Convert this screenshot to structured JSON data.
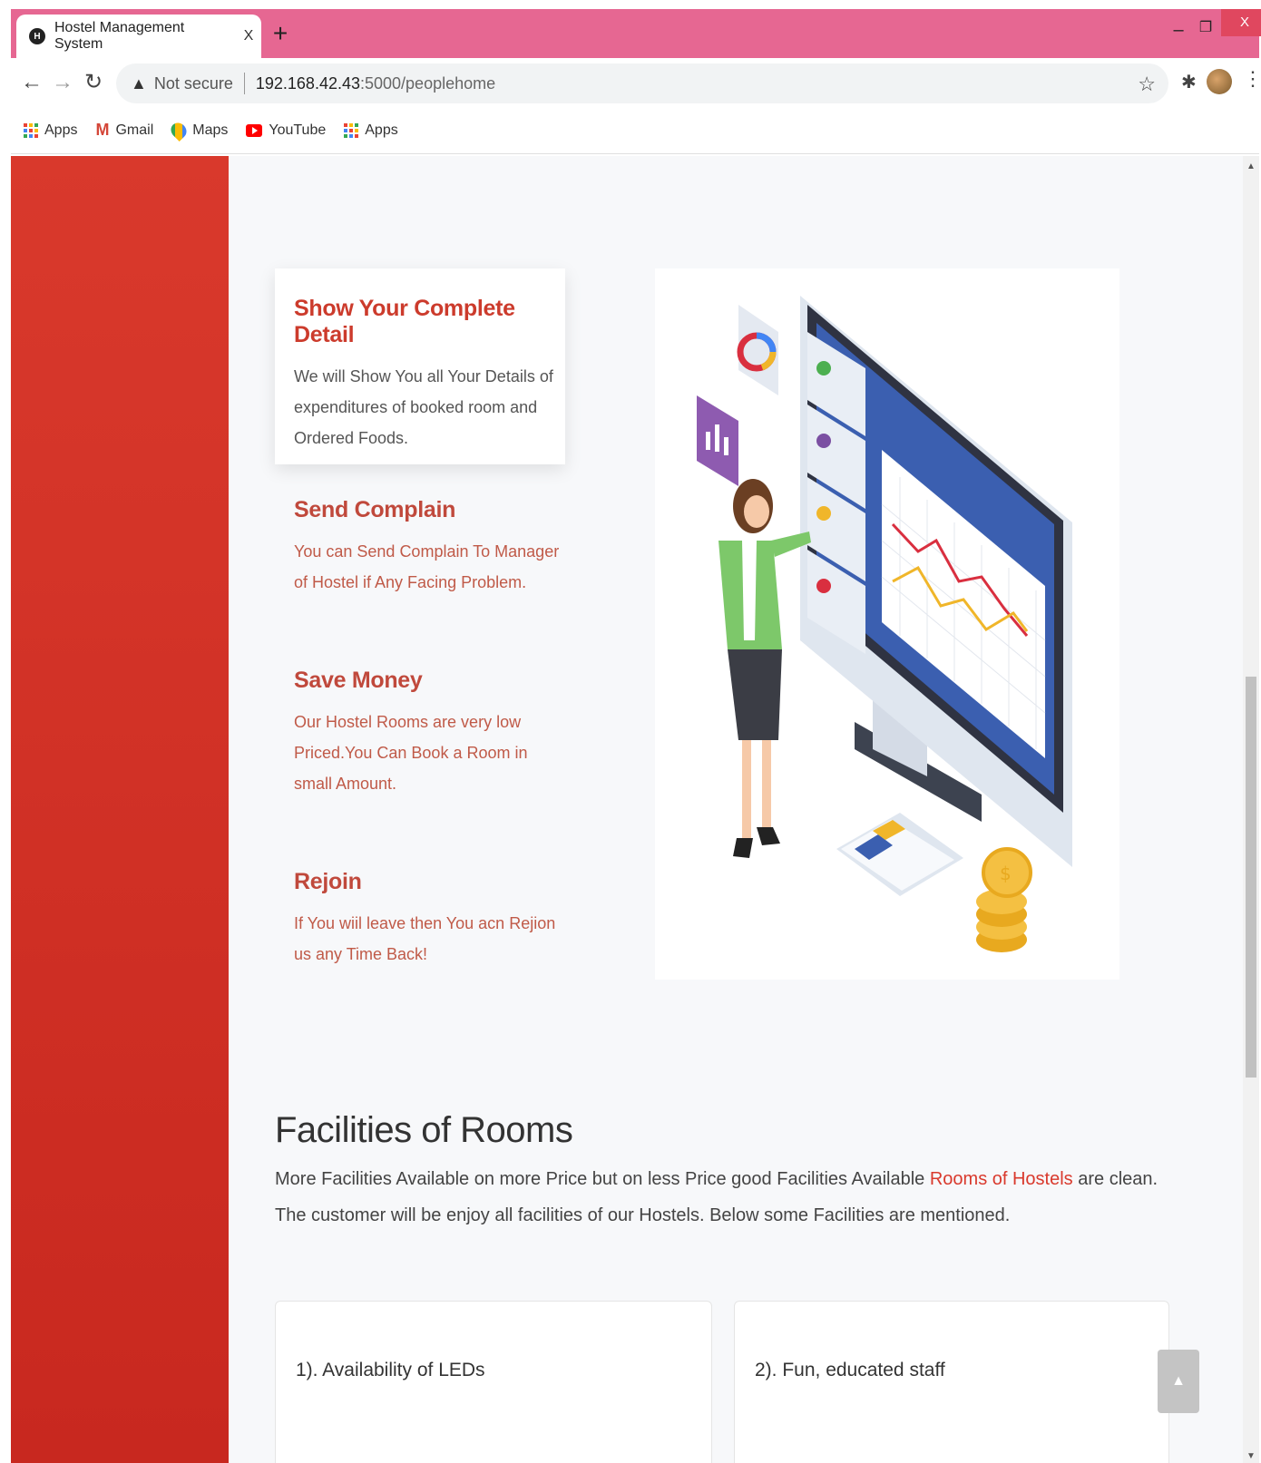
{
  "browser": {
    "tab_title": "Hostel Management System",
    "tab_close": "X",
    "new_tab": "+",
    "win_min": "–",
    "win_max": "❐",
    "win_close": "X",
    "security_text": "Not secure",
    "url_host": "192.168.42.43",
    "url_path": ":5000/peoplehome",
    "bookmarks": [
      {
        "label": "Apps",
        "icon": "apps-grid-icon"
      },
      {
        "label": "Gmail",
        "icon": "gmail-icon"
      },
      {
        "label": "Maps",
        "icon": "maps-icon"
      },
      {
        "label": "YouTube",
        "icon": "youtube-icon"
      },
      {
        "label": "Apps",
        "icon": "apps-grid-icon"
      }
    ]
  },
  "features": [
    {
      "title": "Show Your Complete Detail",
      "text": "We will Show You all Your Details of expenditures of booked room and Ordered Foods."
    },
    {
      "title": "Send Complain",
      "text": "You can Send Complain To Manager of Hostel if Any Facing Problem."
    },
    {
      "title": "Save Money",
      "text": "Our Hostel Rooms are very low Priced.You Can Book a Room in small Amount."
    },
    {
      "title": "Rejoin",
      "text": "If You wiil leave then You acn Rejion us any Time Back!"
    }
  ],
  "facilities": {
    "title": "Facilities of Rooms",
    "text_before": "More Facilities Available on more Price but on less Price good Facilities Available ",
    "highlight": "Rooms of Hostels",
    "text_after": " are clean. The customer will be enjoy all facilities of our Hostels. Below some Facilities are mentioned.",
    "items": [
      "1). Availability of LEDs",
      "2). Fun, educated staff"
    ]
  },
  "colors": {
    "tabbar": "#e66792",
    "sidebar": "#d9392c",
    "accent": "#cc3b2c",
    "feature_text": "#c05a48"
  }
}
